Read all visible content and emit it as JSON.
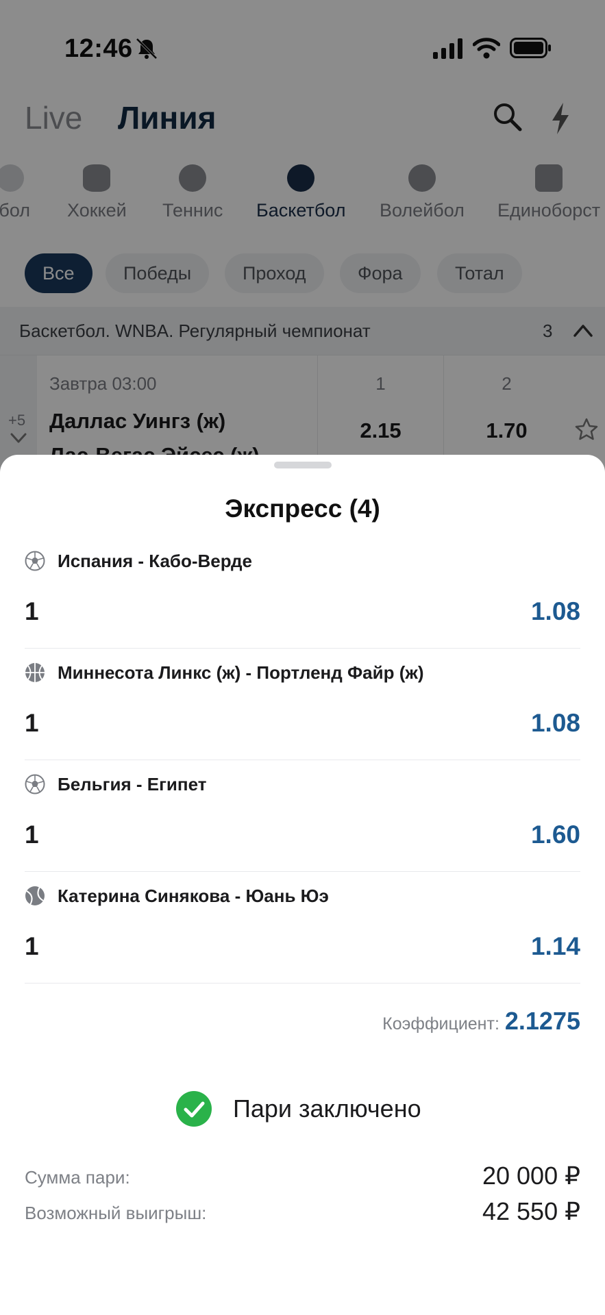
{
  "status_bar": {
    "time": "12:46"
  },
  "header": {
    "tabs": [
      {
        "label": "Live"
      },
      {
        "label": "Линия"
      }
    ]
  },
  "sports": [
    {
      "label": "тбол"
    },
    {
      "label": "Хоккей"
    },
    {
      "label": "Теннис"
    },
    {
      "label": "Баскетбол"
    },
    {
      "label": "Волейбол"
    },
    {
      "label": "Единоборст"
    }
  ],
  "filters": [
    {
      "label": "Все"
    },
    {
      "label": "Победы"
    },
    {
      "label": "Проход"
    },
    {
      "label": "Фора"
    },
    {
      "label": "Тотал"
    }
  ],
  "league": {
    "title": "Баскетбол. WNBA. Регулярный чемпионат",
    "count": "3"
  },
  "match": {
    "time": "Завтра 03:00",
    "team1": "Даллас Уингз (ж)",
    "team2": "Лас-Вегас Эйсес (ж)",
    "more": "+5",
    "odds": [
      {
        "label": "1",
        "value": "2.15"
      },
      {
        "label": "2",
        "value": "1.70"
      }
    ]
  },
  "sheet": {
    "title": "Экспресс (4)",
    "bets": [
      {
        "sport_icon": "soccer-ball-icon",
        "event": "Испания - Кабо-Верде",
        "outcome": "1",
        "odd": "1.08"
      },
      {
        "sport_icon": "basketball-icon",
        "event": "Миннесота Линкс (ж) - Портленд Файр (ж)",
        "outcome": "1",
        "odd": "1.08"
      },
      {
        "sport_icon": "soccer-ball-icon",
        "event": "Бельгия - Египет",
        "outcome": "1",
        "odd": "1.60"
      },
      {
        "sport_icon": "tennis-ball-icon",
        "event": "Катерина Синякова - Юань Юэ",
        "outcome": "1",
        "odd": "1.14"
      }
    ],
    "coefficient_label": "Коэффициент:",
    "coefficient_value": "2.1275",
    "success_text": "Пари заключено",
    "stake_label": "Сумма пари:",
    "stake_value": "20 000 ₽",
    "win_label": "Возможный выигрыш:",
    "win_value": "42 550 ₽"
  },
  "colors": {
    "accent": "#1d5a91",
    "success": "#2ab24a",
    "active_chip": "#1b3a5e",
    "header_active": "#122a44"
  }
}
